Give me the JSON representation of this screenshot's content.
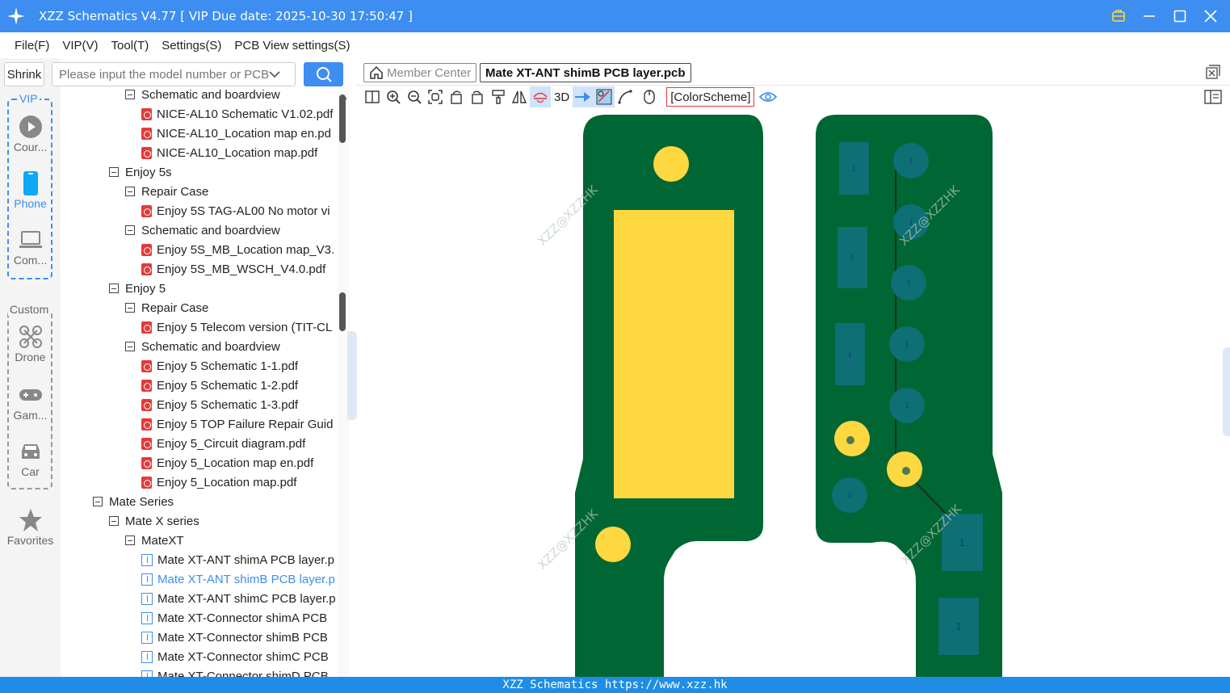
{
  "window": {
    "title": "XZZ Schematics V4.77 [ VIP Due date: 2025-10-30 17:50:47 ]"
  },
  "menu": [
    "File(F)",
    "VIP(V)",
    "Tool(T)",
    "Settings(S)",
    "PCB View settings(S)"
  ],
  "search": {
    "shrink_label": "Shrink",
    "placeholder": "Please input the model number or PCB"
  },
  "rail": {
    "vip_label": "VIP",
    "custom_label": "Custom",
    "items": [
      {
        "label": "Cour...",
        "icon": "play-circle-icon"
      },
      {
        "label": "Phone",
        "icon": "phone-icon"
      },
      {
        "label": "Com...",
        "icon": "laptop-icon"
      },
      {
        "label": "Drone",
        "icon": "drone-icon"
      },
      {
        "label": "Gam...",
        "icon": "gamepad-icon"
      },
      {
        "label": "Car",
        "icon": "car-icon"
      },
      {
        "label": "Favorites",
        "icon": "star-icon"
      }
    ]
  },
  "tree": [
    {
      "type": "folder",
      "level": 3,
      "label": "Schematic and boardview"
    },
    {
      "type": "pdf",
      "level": 4,
      "label": "NICE-AL10 Schematic V1.02.pdf"
    },
    {
      "type": "pdf",
      "level": 4,
      "label": "NICE-AL10_Location map en.pd"
    },
    {
      "type": "pdf",
      "level": 4,
      "label": "NICE-AL10_Location map.pdf"
    },
    {
      "type": "folder",
      "level": 2,
      "label": "Enjoy 5s"
    },
    {
      "type": "folder",
      "level": 3,
      "label": "Repair Case"
    },
    {
      "type": "pdf",
      "level": 4,
      "label": "Enjoy 5S TAG-AL00 No motor vi"
    },
    {
      "type": "folder",
      "level": 3,
      "label": "Schematic and boardview"
    },
    {
      "type": "pdf",
      "level": 4,
      "label": "Enjoy 5S_MB_Location map_V3."
    },
    {
      "type": "pdf",
      "level": 4,
      "label": "Enjoy 5S_MB_WSCH_V4.0.pdf"
    },
    {
      "type": "folder",
      "level": 2,
      "label": "Enjoy 5"
    },
    {
      "type": "folder",
      "level": 3,
      "label": "Repair Case"
    },
    {
      "type": "pdf",
      "level": 4,
      "label": "Enjoy 5 Telecom version (TIT-CL"
    },
    {
      "type": "folder",
      "level": 3,
      "label": "Schematic and boardview"
    },
    {
      "type": "pdf",
      "level": 4,
      "label": "Enjoy 5 Schematic 1-1.pdf"
    },
    {
      "type": "pdf",
      "level": 4,
      "label": "Enjoy 5 Schematic 1-2.pdf"
    },
    {
      "type": "pdf",
      "level": 4,
      "label": "Enjoy 5 Schematic 1-3.pdf"
    },
    {
      "type": "pdf",
      "level": 4,
      "label": "Enjoy 5 TOP Failure Repair Guid"
    },
    {
      "type": "pdf",
      "level": 4,
      "label": "Enjoy 5_Circuit diagram.pdf"
    },
    {
      "type": "pdf",
      "level": 4,
      "label": "Enjoy 5_Location map en.pdf"
    },
    {
      "type": "pdf",
      "level": 4,
      "label": "Enjoy 5_Location map.pdf"
    },
    {
      "type": "folder",
      "level": 1,
      "label": "Mate Series"
    },
    {
      "type": "folder",
      "level": 2,
      "label": "Mate X series"
    },
    {
      "type": "folder",
      "level": 3,
      "label": "MateXT"
    },
    {
      "type": "pcb",
      "level": 4,
      "label": "Mate XT-ANT shimA PCB layer.p"
    },
    {
      "type": "pcb",
      "level": 4,
      "label": "Mate XT-ANT shimB PCB layer.p",
      "selected": true
    },
    {
      "type": "pcb",
      "level": 4,
      "label": "Mate XT-ANT shimC PCB layer.p"
    },
    {
      "type": "pcb",
      "level": 4,
      "label": "Mate XT-Connector shimA PCB"
    },
    {
      "type": "pcb",
      "level": 4,
      "label": "Mate XT-Connector shimB PCB"
    },
    {
      "type": "pcb",
      "level": 4,
      "label": "Mate XT-Connector shimC PCB"
    },
    {
      "type": "pcb",
      "level": 4,
      "label": "Mate XT-Connector shimD PCB"
    }
  ],
  "tabs": {
    "member": "Member Center",
    "active": "Mate XT-ANT shimB PCB layer.pcb"
  },
  "toolbar": {
    "three_d": "3D",
    "color_scheme": "[ColorScheme]"
  },
  "pcb": {
    "watermark": "XZZ@XZZHK",
    "pad_label": "1"
  },
  "colors": {
    "accent": "#3d8ef0",
    "board": "#006633",
    "pad_yellow": "#fdd840",
    "pad_teal": "#0e6f74"
  },
  "status": "XZZ Schematics https://www.xzz.hk"
}
